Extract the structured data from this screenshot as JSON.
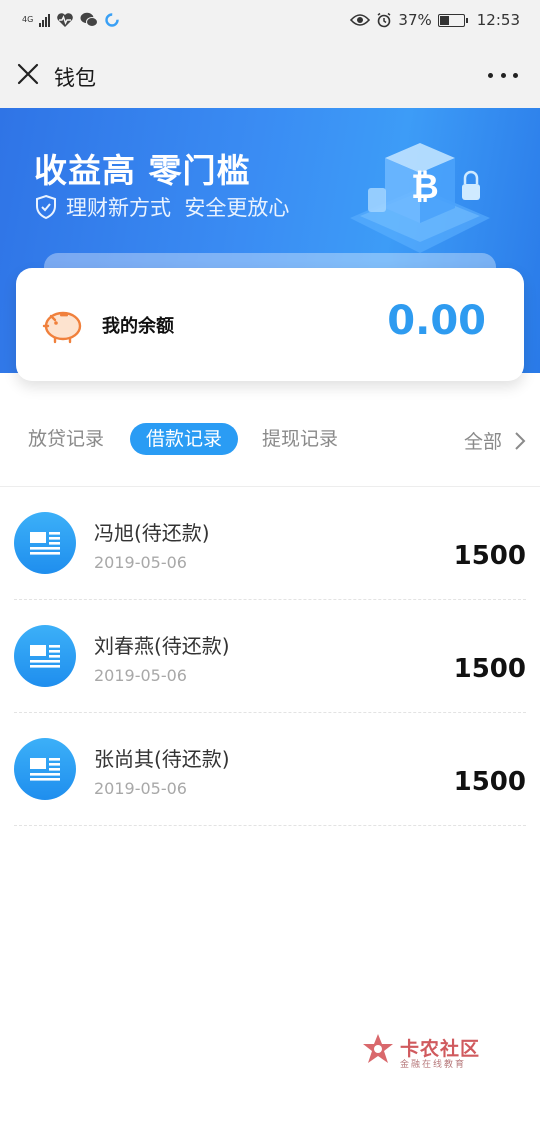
{
  "status_bar": {
    "network": "4G",
    "battery": "37%",
    "battery_level": 0.37,
    "time": "12:53"
  },
  "nav": {
    "title": "钱包"
  },
  "banner": {
    "title": "收益高 零门槛",
    "subtitle": "理财新方式  安全更放心"
  },
  "balance": {
    "label": "我的余额",
    "amount": "0.00"
  },
  "tabs": {
    "items": [
      {
        "label": "放贷记录",
        "active": false
      },
      {
        "label": "借款记录",
        "active": true
      },
      {
        "label": "提现记录",
        "active": false
      }
    ],
    "all_label": "全部"
  },
  "records": [
    {
      "name": "冯旭(待还款)",
      "date": "2019-05-06",
      "amount": "1500"
    },
    {
      "name": "刘春燕(待还款)",
      "date": "2019-05-06",
      "amount": "1500"
    },
    {
      "name": "张尚其(待还款)",
      "date": "2019-05-06",
      "amount": "1500"
    }
  ],
  "watermark": {
    "title": "卡农社区",
    "subtitle": "金融在线教育"
  },
  "colors": {
    "accent": "#2a9cf4",
    "banner": "#3a8cf3",
    "balance_amount": "#2e9bf0"
  }
}
